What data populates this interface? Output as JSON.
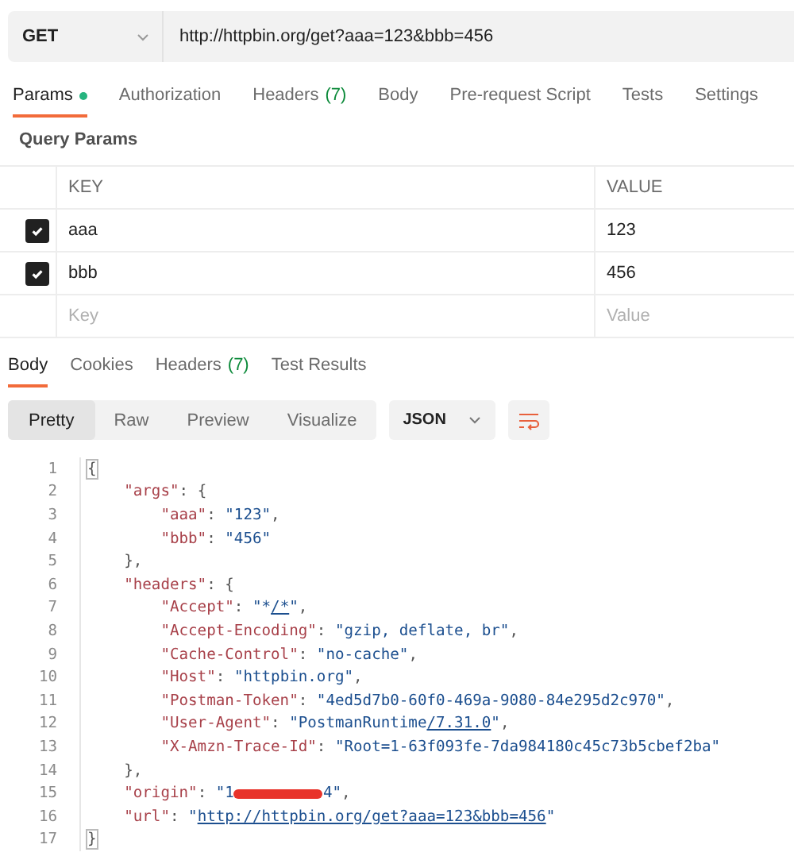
{
  "request": {
    "method": "GET",
    "url": "http://httpbin.org/get?aaa=123&bbb=456"
  },
  "request_tabs": [
    {
      "label": "Params",
      "dot": true,
      "selected": true
    },
    {
      "label": "Authorization",
      "dot": false,
      "selected": false
    },
    {
      "label": "Headers",
      "count": "(7)",
      "dot": false,
      "selected": false
    },
    {
      "label": "Body",
      "dot": false,
      "selected": false
    },
    {
      "label": "Pre-request Script",
      "dot": false,
      "selected": false
    },
    {
      "label": "Tests",
      "dot": false,
      "selected": false
    },
    {
      "label": "Settings",
      "dot": false,
      "selected": false
    }
  ],
  "query_params": {
    "title": "Query Params",
    "columns": [
      "KEY",
      "VALUE"
    ],
    "rows": [
      {
        "key": "aaa",
        "value": "123",
        "checked": true
      },
      {
        "key": "bbb",
        "value": "456",
        "checked": true
      }
    ],
    "new_row": {
      "key_placeholder": "Key",
      "value_placeholder": "Value"
    }
  },
  "response_tabs": [
    {
      "label": "Body",
      "selected": true
    },
    {
      "label": "Cookies",
      "selected": false
    },
    {
      "label": "Headers",
      "count": "(7)",
      "selected": false
    },
    {
      "label": "Test Results",
      "selected": false
    }
  ],
  "view_modes": [
    {
      "label": "Pretty",
      "selected": true
    },
    {
      "label": "Raw",
      "selected": false
    },
    {
      "label": "Preview",
      "selected": false
    },
    {
      "label": "Visualize",
      "selected": false
    }
  ],
  "format": "JSON",
  "code_lines": [
    {
      "number": "1",
      "tokens": [
        {
          "kind": "brace",
          "text": "{"
        }
      ]
    },
    {
      "number": "2",
      "tokens": [
        {
          "kind": "key",
          "text": "    \"args\""
        },
        {
          "kind": "punct",
          "text": ": {"
        }
      ]
    },
    {
      "number": "3",
      "tokens": [
        {
          "kind": "key",
          "text": "        \"aaa\""
        },
        {
          "kind": "punct",
          "text": ": "
        },
        {
          "kind": "string",
          "text": "\"123\""
        },
        {
          "kind": "punct",
          "text": ","
        }
      ]
    },
    {
      "number": "4",
      "tokens": [
        {
          "kind": "key",
          "text": "        \"bbb\""
        },
        {
          "kind": "punct",
          "text": ": "
        },
        {
          "kind": "string",
          "text": "\"456\""
        }
      ]
    },
    {
      "number": "5",
      "tokens": [
        {
          "kind": "punct",
          "text": "    },"
        }
      ]
    },
    {
      "number": "6",
      "tokens": [
        {
          "kind": "key",
          "text": "    \"headers\""
        },
        {
          "kind": "punct",
          "text": ": {"
        }
      ]
    },
    {
      "number": "7",
      "tokens": [
        {
          "kind": "key",
          "text": "        \"Accept\""
        },
        {
          "kind": "punct",
          "text": ": "
        },
        {
          "kind": "string",
          "text": "\"*"
        },
        {
          "kind": "link",
          "text": "/*"
        },
        {
          "kind": "string",
          "text": "\""
        },
        {
          "kind": "punct",
          "text": ","
        }
      ]
    },
    {
      "number": "8",
      "tokens": [
        {
          "kind": "key",
          "text": "        \"Accept-Encoding\""
        },
        {
          "kind": "punct",
          "text": ": "
        },
        {
          "kind": "string",
          "text": "\"gzip, deflate, br\""
        },
        {
          "kind": "punct",
          "text": ","
        }
      ]
    },
    {
      "number": "9",
      "tokens": [
        {
          "kind": "key",
          "text": "        \"Cache-Control\""
        },
        {
          "kind": "punct",
          "text": ": "
        },
        {
          "kind": "string",
          "text": "\"no-cache\""
        },
        {
          "kind": "punct",
          "text": ","
        }
      ]
    },
    {
      "number": "10",
      "tokens": [
        {
          "kind": "key",
          "text": "        \"Host\""
        },
        {
          "kind": "punct",
          "text": ": "
        },
        {
          "kind": "string",
          "text": "\"httpbin.org\""
        },
        {
          "kind": "punct",
          "text": ","
        }
      ]
    },
    {
      "number": "11",
      "tokens": [
        {
          "kind": "key",
          "text": "        \"Postman-Token\""
        },
        {
          "kind": "punct",
          "text": ": "
        },
        {
          "kind": "string",
          "text": "\"4ed5d7b0-60f0-469a-9080-84e295d2c970\""
        },
        {
          "kind": "punct",
          "text": ","
        }
      ]
    },
    {
      "number": "12",
      "tokens": [
        {
          "kind": "key",
          "text": "        \"User-Agent\""
        },
        {
          "kind": "punct",
          "text": ": "
        },
        {
          "kind": "string",
          "text": "\"PostmanRuntime"
        },
        {
          "kind": "link",
          "text": "/7.31.0"
        },
        {
          "kind": "string",
          "text": "\""
        },
        {
          "kind": "punct",
          "text": ","
        }
      ]
    },
    {
      "number": "13",
      "tokens": [
        {
          "kind": "key",
          "text": "        \"X-Amzn-Trace-Id\""
        },
        {
          "kind": "punct",
          "text": ": "
        },
        {
          "kind": "string",
          "text": "\"Root=1-63f093fe-7da984180c45c73b5cbef2ba\""
        }
      ]
    },
    {
      "number": "14",
      "tokens": [
        {
          "kind": "punct",
          "text": "    },"
        }
      ]
    },
    {
      "number": "15",
      "tokens": [
        {
          "kind": "key",
          "text": "    \"origin\""
        },
        {
          "kind": "punct",
          "text": ": "
        },
        {
          "kind": "string",
          "text": "\"1"
        },
        {
          "kind": "redaction"
        },
        {
          "kind": "string",
          "text": "4\""
        },
        {
          "kind": "punct",
          "text": ","
        }
      ]
    },
    {
      "number": "16",
      "tokens": [
        {
          "kind": "key",
          "text": "    \"url\""
        },
        {
          "kind": "punct",
          "text": ": "
        },
        {
          "kind": "string",
          "text": "\""
        },
        {
          "kind": "link",
          "text": "http://httpbin.org/get?aaa=123&bbb=456"
        },
        {
          "kind": "string",
          "text": "\""
        }
      ]
    },
    {
      "number": "17",
      "tokens": [
        {
          "kind": "brace",
          "text": "}"
        }
      ]
    }
  ]
}
